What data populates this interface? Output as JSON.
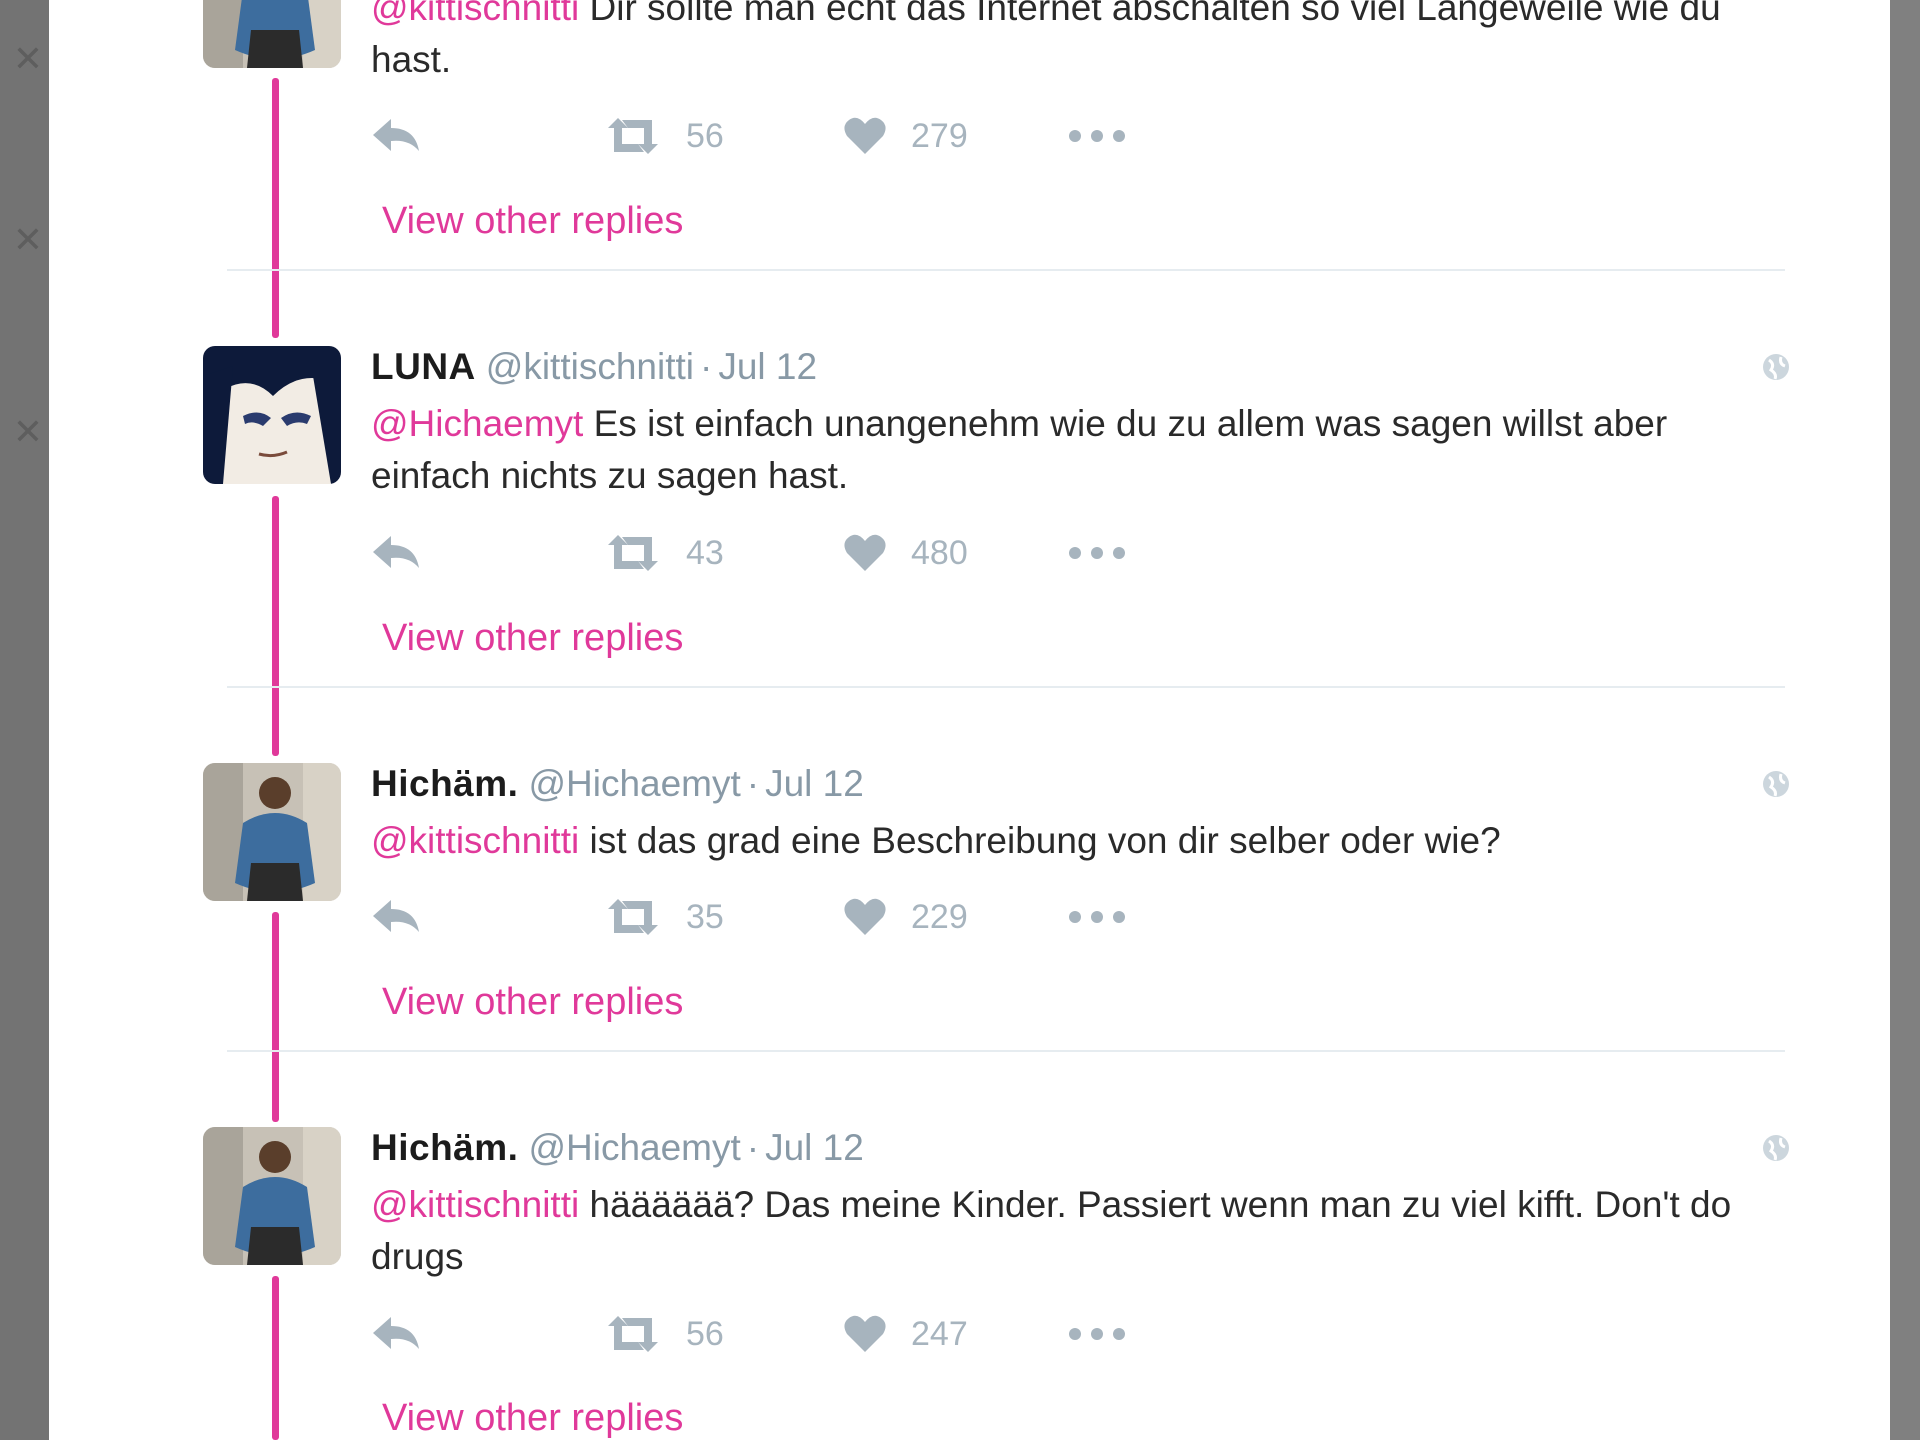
{
  "theme": {
    "accent": "#e0399a",
    "muted": "#8899a6"
  },
  "left_close_icons": [
    "close-icon",
    "close-icon",
    "close-icon"
  ],
  "tweets": [
    {
      "author_name": "",
      "handle": "",
      "date": "",
      "mention": "@kittischnitti",
      "text": " Dir sollte man echt das Internet abschalten so viel Langeweile wie du hast.",
      "retweets": "56",
      "likes": "279",
      "view_replies": "View other replies",
      "avatar": "man-sitting-blue-jacket"
    },
    {
      "author_name": "LUNA",
      "handle": "@kittischnitti",
      "date": "Jul 12",
      "mention": "@Hichaemyt",
      "text": " Es ist einfach unangenehm wie du zu allem was sagen willst aber einfach nichts zu sagen hast.",
      "retweets": "43",
      "likes": "480",
      "view_replies": "View other replies",
      "avatar": "anime-girl-dark-hair"
    },
    {
      "author_name": "Hichäm.",
      "handle": "@Hichaemyt",
      "date": "Jul 12",
      "mention": "@kittischnitti",
      "text": " ist das grad eine Beschreibung von dir selber oder wie?",
      "retweets": "35",
      "likes": "229",
      "view_replies": "View other replies",
      "avatar": "man-sitting-blue-jacket"
    },
    {
      "author_name": "Hichäm.",
      "handle": "@Hichaemyt",
      "date": "Jul 12",
      "mention": "@kittischnitti",
      "text": " hääääää? Das meine Kinder. Passiert wenn man zu viel kifft. Don't do drugs",
      "retweets": "56",
      "likes": "247",
      "view_replies": "View other replies",
      "avatar": "man-sitting-blue-jacket"
    }
  ],
  "separator": "·",
  "icons": {
    "reply": "reply-icon",
    "retweet": "retweet-icon",
    "like": "heart-icon",
    "more": "more-dots-icon",
    "public": "globe-icon"
  }
}
